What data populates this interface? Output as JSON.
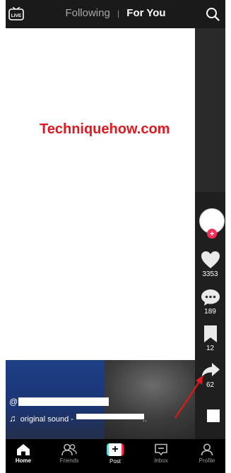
{
  "topbar": {
    "live_label": "LIVE",
    "tabs": [
      "Following",
      "For You"
    ],
    "active_tab": "For You"
  },
  "watermark": "Techniquehow.com",
  "actions": {
    "likes": "3353",
    "comments": "189",
    "saves": "12",
    "shares": "62"
  },
  "caption": {
    "username_prefix": "@",
    "sound_label": "original sound -",
    "sound_suffix": ".."
  },
  "bottom_nav": [
    {
      "label": "Home",
      "icon": "home-icon",
      "active": true
    },
    {
      "label": "Friends",
      "icon": "friends-icon",
      "active": false
    },
    {
      "label": "Post",
      "icon": "post-icon",
      "active": false
    },
    {
      "label": "Inbox",
      "icon": "inbox-icon",
      "active": false
    },
    {
      "label": "Profile",
      "icon": "profile-icon",
      "active": false
    }
  ],
  "colors": {
    "accent_red": "#fe2c55",
    "accent_cyan": "#25f4ee",
    "watermark": "#e0181f"
  }
}
